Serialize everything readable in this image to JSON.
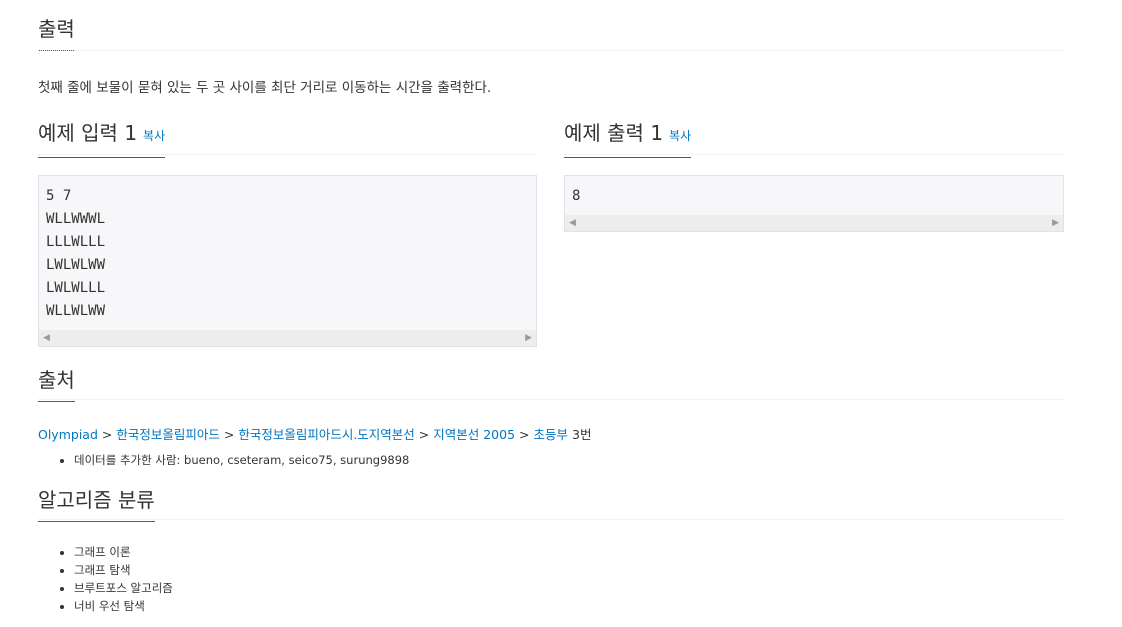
{
  "output_section": {
    "title": "출력",
    "description": "첫째 줄에 보물이 묻혀 있는 두 곳 사이를 최단 거리로 이동하는 시간을 출력한다."
  },
  "sample_input": {
    "title": "예제 입력 1",
    "copy_label": "복사",
    "content": "5 7\nWLLWWWL\nLLLWLLL\nLWLWLWW\nLWLWLLL\nWLLWLWW"
  },
  "sample_output": {
    "title": "예제 출력 1",
    "copy_label": "복사",
    "content": "8"
  },
  "source_section": {
    "title": "출처",
    "breadcrumb": [
      "Olympiad",
      "한국정보올림피아드",
      "한국정보올림피아드시.도지역본선",
      "지역본선 2005",
      "초등부"
    ],
    "breadcrumb_suffix": "3번",
    "separator": ">",
    "contributors": "데이터를 추가한 사람: bueno, cseteram, seico75, surung9898"
  },
  "algorithm_section": {
    "title": "알고리즘 분류",
    "tags": [
      "그래프 이론",
      "그래프 탐색",
      "브루트포스 알고리즘",
      "너비 우선 탐색"
    ]
  },
  "scroll_arrows": {
    "left": "◀",
    "right": "▶"
  },
  "colors": {
    "link": "#0076c0",
    "heading_underline": "#0076c0",
    "sample_bg": "#f7f7f9"
  }
}
